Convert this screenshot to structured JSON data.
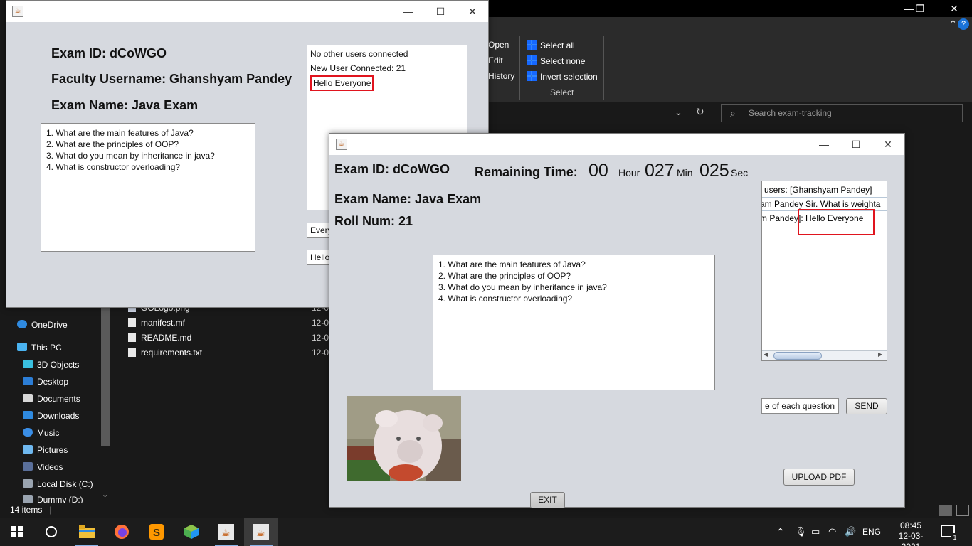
{
  "explorer": {
    "ribbon": {
      "open_label": "Open",
      "edit_label": "Edit",
      "history_label": "History",
      "select_all_label": "Select all",
      "select_none_label": "Select none",
      "invert_selection_label": "Invert selection",
      "group_select_label": "Select"
    },
    "search": {
      "placeholder": "Search exam-tracking"
    },
    "nav_items": [
      {
        "label": "OneDrive",
        "icon": "cloud-icon"
      },
      {
        "label": "This PC",
        "icon": "computer-icon"
      },
      {
        "label": "3D Objects",
        "icon": "cube-icon"
      },
      {
        "label": "Desktop",
        "icon": "desktop-icon"
      },
      {
        "label": "Documents",
        "icon": "document-icon"
      },
      {
        "label": "Downloads",
        "icon": "download-icon"
      },
      {
        "label": "Music",
        "icon": "music-icon"
      },
      {
        "label": "Pictures",
        "icon": "picture-icon"
      },
      {
        "label": "Videos",
        "icon": "video-icon"
      },
      {
        "label": "Local Disk (C:)",
        "icon": "disk-icon"
      },
      {
        "label": "Dummy (D:)",
        "icon": "disk-icon"
      }
    ],
    "files": [
      {
        "name": "GOLogo.png",
        "date": "12-0"
      },
      {
        "name": "manifest.mf",
        "date": "12-0"
      },
      {
        "name": "README.md",
        "date": "12-0"
      },
      {
        "name": "requirements.txt",
        "date": "12-0"
      }
    ],
    "status": "14 items"
  },
  "faculty_window": {
    "exam_id": "Exam ID: dCoWGO",
    "faculty_username": "Faculty Username: Ghanshyam Pandey",
    "exam_name": "Exam Name: Java Exam",
    "questions": [
      "1. What are the main features of Java?",
      "2. What are the principles of OOP?",
      "3. What do you mean by inheritance in java?",
      "4. What is constructor overloading?"
    ],
    "log": [
      "No other users connected",
      "New User Connected: 21",
      "Hello Everyone"
    ],
    "dropdown_value": "Every",
    "message_field_value": "Hello"
  },
  "student_window": {
    "exam_id": "Exam ID: dCoWGO",
    "remaining_label": "Remaining Time:",
    "hours": "00",
    "hour_unit": "Hour",
    "minutes": "027",
    "min_unit": "Min",
    "seconds": "025",
    "sec_unit": "Sec",
    "exam_name": "Exam Name: Java Exam",
    "roll_num": "Roll Num: 21",
    "questions": [
      "1. What are the main features of Java?",
      "2. What are the principles of OOP?",
      "3. What do you mean by inheritance in java?",
      "4. What is constructor overloading?"
    ],
    "chat": [
      "users: [Ghanshyam Pandey]",
      "am Pandey Sir. What is weighta",
      "m Pandey]: Hello Everyone"
    ],
    "chat_highlight": "Hello Everyone",
    "message_field_value": "e of each question",
    "send_label": "SEND",
    "upload_label": "UPLOAD PDF",
    "exit_label": "EXIT"
  },
  "taskbar": {
    "apps": [
      "file-explorer-icon",
      "firefox-icon",
      "sublime-text-icon",
      "box-app-icon",
      "java-icon",
      "java-icon"
    ],
    "language": "ENG",
    "time": "08:45",
    "date": "12-03-2021",
    "notification_count": "1"
  }
}
